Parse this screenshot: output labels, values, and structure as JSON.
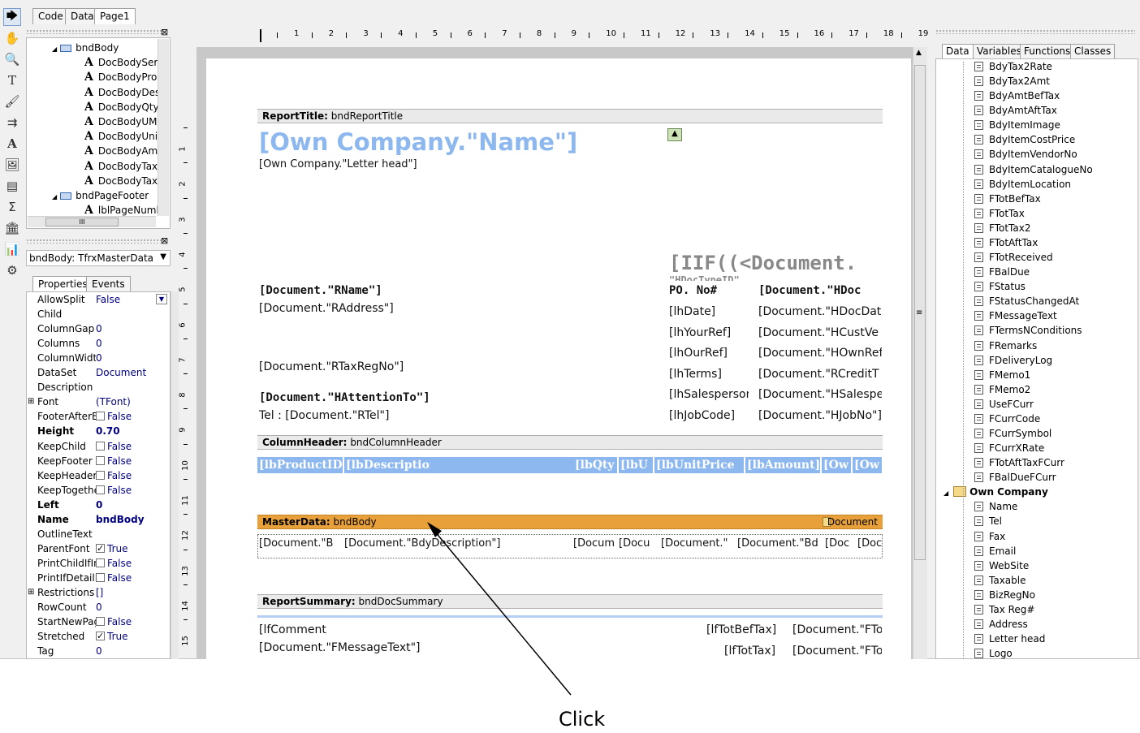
{
  "tabs": [
    "Code",
    "Data",
    "Page1"
  ],
  "tree": {
    "items": [
      {
        "label": "bndBody",
        "type": "band"
      },
      {
        "label": "DocBodySer",
        "type": "text"
      },
      {
        "label": "DocBodyPro",
        "type": "text"
      },
      {
        "label": "DocBodyDes",
        "type": "text"
      },
      {
        "label": "DocBodyQty",
        "type": "text"
      },
      {
        "label": "DocBodyUM",
        "type": "text"
      },
      {
        "label": "DocBodyUni",
        "type": "text"
      },
      {
        "label": "DocBodyAm",
        "type": "text"
      },
      {
        "label": "DocBodyTax",
        "type": "text"
      },
      {
        "label": "DocBodyTax",
        "type": "text"
      },
      {
        "label": "bndPageFooter",
        "type": "band"
      },
      {
        "label": "lblPageNumb",
        "type": "text"
      }
    ],
    "hscroll_thumb": "III"
  },
  "object_selector": "bndBody: TfrxMasterData",
  "prop_tabs": [
    "Properties",
    "Events"
  ],
  "properties": [
    {
      "name": "AllowSplit",
      "value": "False",
      "dropdown": true
    },
    {
      "name": "Child",
      "value": ""
    },
    {
      "name": "ColumnGap",
      "value": "0"
    },
    {
      "name": "Columns",
      "value": "0"
    },
    {
      "name": "ColumnWidth",
      "value": "0"
    },
    {
      "name": "DataSet",
      "value": "Document"
    },
    {
      "name": "Description",
      "value": ""
    },
    {
      "name": "Font",
      "value": "(TFont)",
      "expand": true
    },
    {
      "name": "FooterAfterE",
      "value": "False",
      "check": false
    },
    {
      "name": "Height",
      "value": "0.70",
      "bold": true
    },
    {
      "name": "KeepChild",
      "value": "False",
      "check": false
    },
    {
      "name": "KeepFooter",
      "value": "False",
      "check": false
    },
    {
      "name": "KeepHeader",
      "value": "False",
      "check": false
    },
    {
      "name": "KeepTogethe",
      "value": "False",
      "check": false
    },
    {
      "name": "Left",
      "value": "0",
      "bold": true
    },
    {
      "name": "Name",
      "value": "bndBody",
      "bold": true
    },
    {
      "name": "OutlineText",
      "value": ""
    },
    {
      "name": "ParentFont",
      "value": "True",
      "check": true
    },
    {
      "name": "PrintChildIfIn",
      "value": "False",
      "check": false
    },
    {
      "name": "PrintIfDetailE",
      "value": "False",
      "check": false
    },
    {
      "name": "Restrictions",
      "value": "[]",
      "expand": true
    },
    {
      "name": "RowCount",
      "value": "0"
    },
    {
      "name": "StartNewPag",
      "value": "False",
      "check": false
    },
    {
      "name": "Stretched",
      "value": "True",
      "check": true
    },
    {
      "name": "Tag",
      "value": "0"
    }
  ],
  "ruler": [
    "1",
    "2",
    "3",
    "4",
    "5",
    "6",
    "7",
    "8",
    "9",
    "10",
    "11",
    "12",
    "13",
    "14",
    "15",
    "16",
    "17",
    "18",
    "19"
  ],
  "vruler": [
    "1",
    "2",
    "3",
    "4",
    "5",
    "6",
    "7",
    "8",
    "9",
    "10",
    "11",
    "12",
    "13",
    "14",
    "15"
  ],
  "report": {
    "title_band": {
      "type": "ReportTitle:",
      "name": "bndReportTitle"
    },
    "company_name": "[Own Company.\"Name\"]",
    "letter_head": "[Own Company.\"Letter head\"]",
    "iif_expr": "[IIF((<Document.",
    "iif_expr2": "\"HDocTypeID\"",
    "rname": "[Document.\"RName\"]",
    "raddress": "[Document.\"RAddress\"]",
    "rtaxregno": "[Document.\"RTaxRegNo\"]",
    "hattention": "[Document.\"HAttentionTo\"]",
    "tel": "Tel : [Document.\"RTel\"]",
    "po_no": "PO. No#",
    "hdoc": "[Document.\"HDoc",
    "labels": [
      "[lhDate]",
      "[lhYourRef]",
      "[lhOurRef]",
      "[lhTerms]",
      "[lhSalesperson",
      "[lhJobCode]"
    ],
    "values": [
      "[Document.\"HDocDat",
      "[Document.\"HCustVe",
      "[Document.\"HOwnRef",
      "[Document.\"RCreditT",
      "[Document.\"HSalespe",
      "[Document.\"HJobNo\"]"
    ],
    "colheader_band": {
      "type": "ColumnHeader:",
      "name": "bndColumnHeader"
    },
    "colheaders": [
      "[lbProductID",
      "[lbDescription]",
      "[lbQty",
      "[lbU",
      "[lbUnitPrice",
      "[lbAmount]",
      "[Ow",
      "[Ow"
    ],
    "master_band": {
      "type": "MasterData:",
      "name": "bndBody",
      "dataset": "Document"
    },
    "master_fields": [
      "[Document.\"B",
      "[Document.\"BdyDescription\"]",
      "[Docum",
      "[Docu",
      "[Document.\"",
      "[Document.\"Bd",
      "[Doc",
      "[Doc"
    ],
    "summary_band": {
      "type": "ReportSummary:",
      "name": "bndDocSummary"
    },
    "summary": [
      "[lfComment",
      "[Document.\"FMessageText\"]",
      "[lfTotBefTax]",
      "[Document.\"FTo",
      "[lfTotTax]",
      "[Document.\"FTo"
    ]
  },
  "right_tabs": [
    "Data",
    "Variables",
    "Functions",
    "Classes"
  ],
  "fields": [
    "BdyTax2Rate",
    "BdyTax2Amt",
    "BdyAmtBefTax",
    "BdyAmtAftTax",
    "BdyItemImage",
    "BdyItemCostPrice",
    "BdyItemVendorNo",
    "BdyItemCatalogueNo",
    "BdyItemLocation",
    "FTotBefTax",
    "FTotTax",
    "FTotTax2",
    "FTotAftTax",
    "FTotReceived",
    "FBalDue",
    "FStatus",
    "FStatusChangedAt",
    "FMessageText",
    "FTermsNConditions",
    "FRemarks",
    "FDeliveryLog",
    "FMemo1",
    "FMemo2",
    "UseFCurr",
    "FCurrCode",
    "FCurrSymbol",
    "FCurrXRate",
    "FTotAftTaxFCurr",
    "FBalDueFCurr"
  ],
  "own_company": {
    "label": "Own Company",
    "fields": [
      "Name",
      "Tel",
      "Fax",
      "Email",
      "WebSite",
      "Taxable",
      "BizRegNo",
      "Tax Reg#",
      "Address",
      "Letter head",
      "Logo"
    ]
  },
  "annotation": "Click",
  "colors": {
    "master_band": "#e8a13a",
    "header_text": "#8db8ef"
  }
}
